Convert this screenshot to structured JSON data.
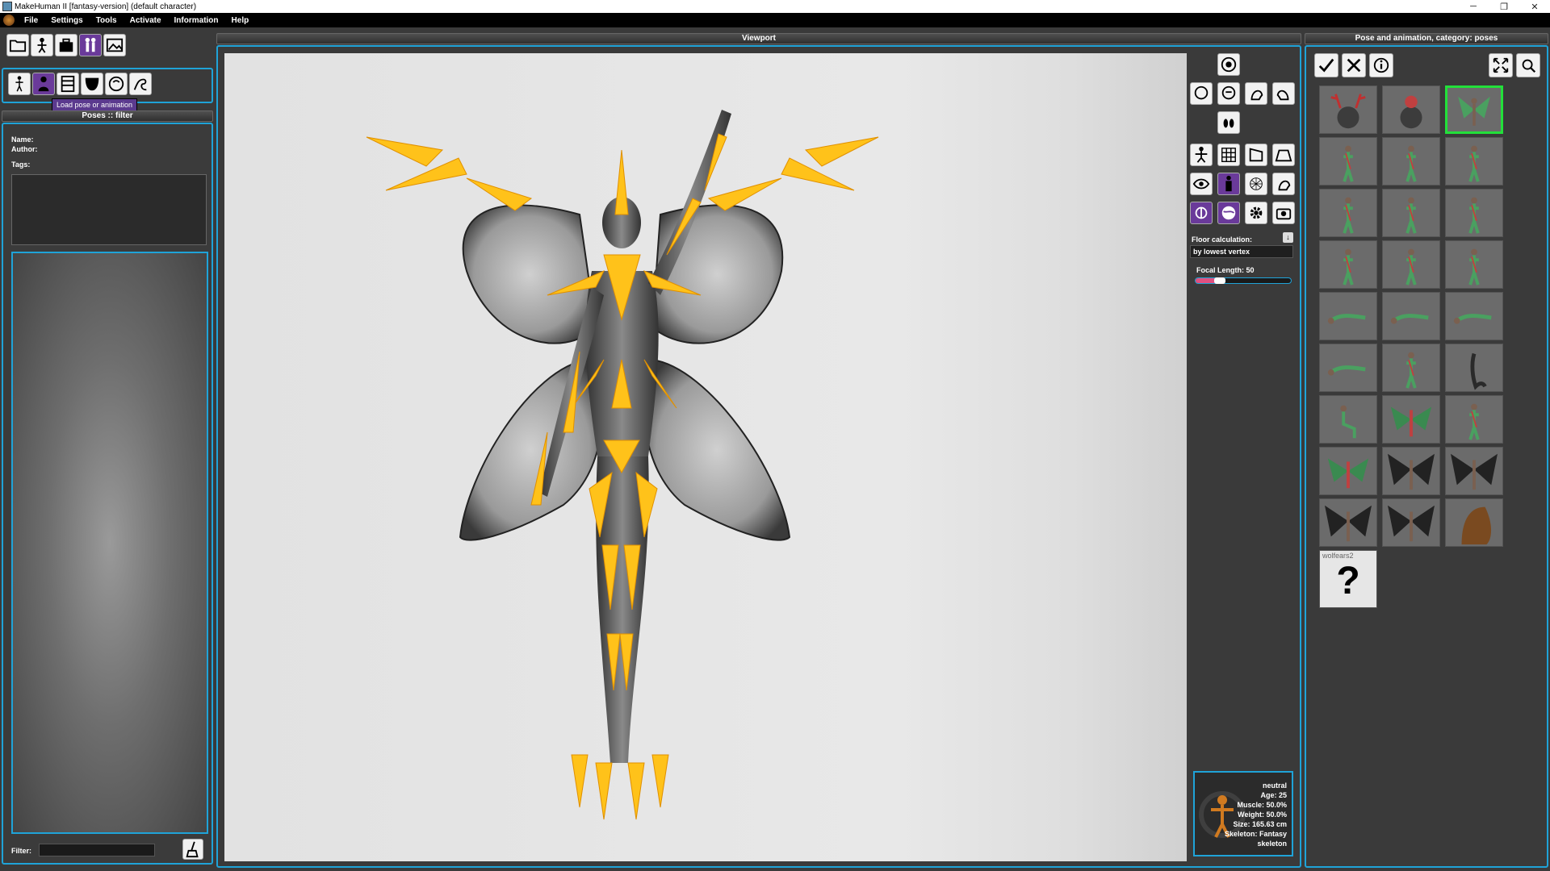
{
  "window": {
    "title": "MakeHuman II [fantasy-version]  (default character)",
    "minimize": "─",
    "restore": "❐",
    "close": "✕"
  },
  "menu": [
    "File",
    "Settings",
    "Tools",
    "Activate",
    "Information",
    "Help"
  ],
  "left": {
    "tooltip": "Load pose or animation",
    "filter_header": "Poses :: filter",
    "name_label": "Name:",
    "author_label": "Author:",
    "tags_label": "Tags:",
    "filter_label": "Filter:",
    "filter_value": ""
  },
  "viewport": {
    "header": "Viewport",
    "floor_label": "Floor calculation:",
    "floor_value": "by lowest vertex",
    "focal_label": "Focal Length: 50",
    "focal_fraction": 0.25,
    "info": [
      "neutral",
      "Age: 25",
      "Muscle: 50.0%",
      "Weight: 50.0%",
      "Size: 165.63 cm",
      "Skeleton: Fantasy",
      "skeleton"
    ]
  },
  "right": {
    "header": "Pose and animation, category: poses",
    "last_label": "wolfears2",
    "unknown_glyph": "?",
    "thumbs": [
      {
        "kind": "antlers",
        "sel": false
      },
      {
        "kind": "flower",
        "sel": false
      },
      {
        "kind": "fairy",
        "sel": true
      },
      {
        "kind": "stand",
        "sel": false
      },
      {
        "kind": "stand",
        "sel": false
      },
      {
        "kind": "stand",
        "sel": false
      },
      {
        "kind": "stand",
        "sel": false
      },
      {
        "kind": "stand",
        "sel": false
      },
      {
        "kind": "stand",
        "sel": false
      },
      {
        "kind": "stand",
        "sel": false
      },
      {
        "kind": "stand",
        "sel": false
      },
      {
        "kind": "stand",
        "sel": false
      },
      {
        "kind": "lying",
        "sel": false
      },
      {
        "kind": "lying",
        "sel": false
      },
      {
        "kind": "lying",
        "sel": false
      },
      {
        "kind": "lying",
        "sel": false
      },
      {
        "kind": "stand",
        "sel": false
      },
      {
        "kind": "tail",
        "sel": false
      },
      {
        "kind": "sit",
        "sel": false
      },
      {
        "kind": "wings",
        "sel": false
      },
      {
        "kind": "stand",
        "sel": false
      },
      {
        "kind": "wings",
        "sel": false
      },
      {
        "kind": "darkwings",
        "sel": false
      },
      {
        "kind": "darkwings",
        "sel": false
      },
      {
        "kind": "darkwings",
        "sel": false
      },
      {
        "kind": "darkwings",
        "sel": false
      },
      {
        "kind": "fur",
        "sel": false
      }
    ]
  },
  "colors": {
    "accent": "#1fa3d8",
    "bone": "#ffc21a",
    "bone_dark": "#ff8c00",
    "select": "#22e03a",
    "purple": "#6a3a9a"
  }
}
